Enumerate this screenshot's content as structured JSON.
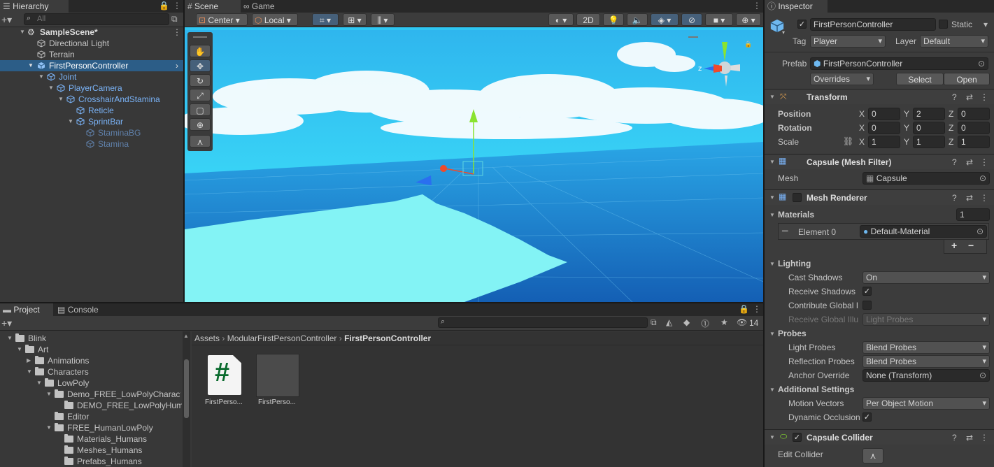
{
  "hierarchy": {
    "tab": "Hierarchy",
    "search_placeholder": "All",
    "items": [
      {
        "label": "SampleScene*"
      },
      {
        "label": "Directional Light"
      },
      {
        "label": "Terrain"
      },
      {
        "label": "FirstPersonController"
      },
      {
        "label": "Joint"
      },
      {
        "label": "PlayerCamera"
      },
      {
        "label": "CrosshairAndStamina"
      },
      {
        "label": "Reticle"
      },
      {
        "label": "SprintBar"
      },
      {
        "label": "StaminaBG"
      },
      {
        "label": "Stamina"
      }
    ]
  },
  "scene": {
    "tabs": [
      "Scene",
      "Game"
    ],
    "toolbar": {
      "pivot": "Center",
      "space": "Local",
      "mode_2d": "2D"
    },
    "gizmo_axis_label": "z",
    "sky_color": "#2fc6f2",
    "ground_color": "#83f3f5"
  },
  "project": {
    "tabs": [
      "Project",
      "Console"
    ],
    "hidden_count": "14",
    "breadcrumb": [
      "Assets",
      "ModularFirstPersonController",
      "FirstPersonController"
    ],
    "tree": [
      {
        "label": "Blink"
      },
      {
        "label": "Art"
      },
      {
        "label": "Animations"
      },
      {
        "label": "Characters"
      },
      {
        "label": "LowPoly"
      },
      {
        "label": "Demo_FREE_LowPolyCharacters"
      },
      {
        "label": "DEMO_FREE_LowPolyHumans"
      },
      {
        "label": "Editor"
      },
      {
        "label": "FREE_HumanLowPoly"
      },
      {
        "label": "Materials_Humans"
      },
      {
        "label": "Meshes_Humans"
      },
      {
        "label": "Prefabs_Humans"
      }
    ],
    "assets": [
      {
        "label": "FirstPerso...",
        "glyph": "#"
      },
      {
        "label": "FirstPerso..."
      }
    ]
  },
  "inspector": {
    "tab": "Inspector",
    "object_name": "FirstPersonController",
    "static_label": "Static",
    "tag_label": "Tag",
    "tag_value": "Player",
    "layer_label": "Layer",
    "layer_value": "Default",
    "prefab_label": "Prefab",
    "prefab_value": "FirstPersonController",
    "overrides": "Overrides",
    "select": "Select",
    "open": "Open",
    "transform": {
      "title": "Transform",
      "position_label": "Position",
      "rotation_label": "Rotation",
      "scale_label": "Scale",
      "position": {
        "x": "0",
        "y": "2",
        "z": "0"
      },
      "rotation": {
        "x": "0",
        "y": "0",
        "z": "0"
      },
      "scale": {
        "x": "1",
        "y": "1",
        "z": "1"
      }
    },
    "mesh_filter": {
      "title": "Capsule (Mesh Filter)",
      "mesh_label": "Mesh",
      "mesh_value": "Capsule"
    },
    "mesh_renderer": {
      "title": "Mesh Renderer",
      "materials_label": "Materials",
      "materials_count": "1",
      "element_label": "Element 0",
      "element_value": "Default-Material",
      "lighting": "Lighting",
      "cast_shadows_label": "Cast Shadows",
      "cast_shadows_value": "On",
      "receive_shadows_label": "Receive Shadows",
      "contribute_gi_label": "Contribute Global I",
      "receive_gi_label": "Receive Global Illu",
      "receive_gi_value": "Light Probes",
      "probes": "Probes",
      "light_probes_label": "Light Probes",
      "light_probes_value": "Blend Probes",
      "reflection_probes_label": "Reflection Probes",
      "reflection_probes_value": "Blend Probes",
      "anchor_label": "Anchor Override",
      "anchor_value": "None (Transform)",
      "additional": "Additional Settings",
      "motion_vectors_label": "Motion Vectors",
      "motion_vectors_value": "Per Object Motion",
      "dynamic_occlusion_label": "Dynamic Occlusion"
    },
    "capsule_collider": {
      "title": "Capsule Collider",
      "edit_label": "Edit Collider"
    }
  }
}
